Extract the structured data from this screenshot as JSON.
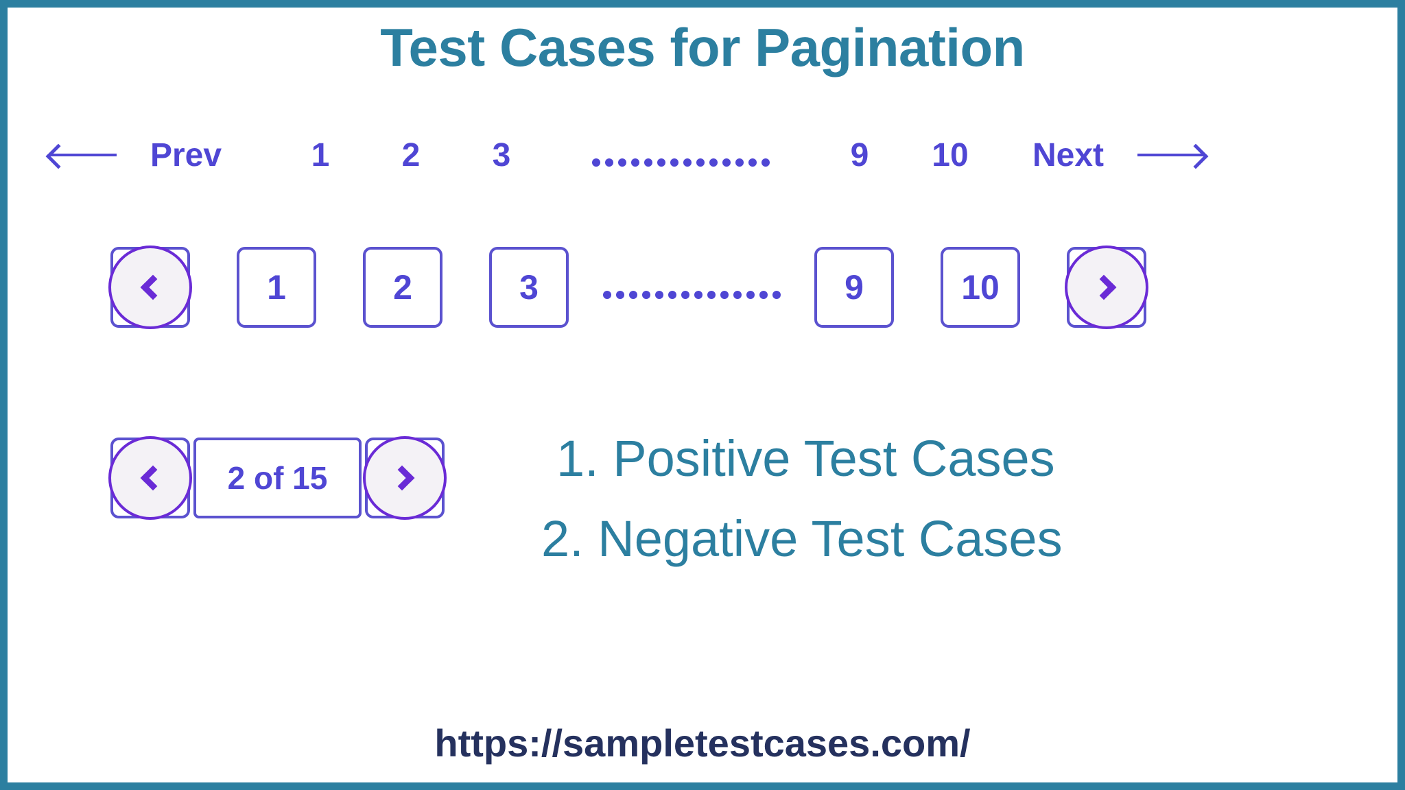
{
  "page": {
    "title": "Test Cases for Pagination",
    "border_color": "#2c7fa0",
    "background": "#ffffff"
  },
  "colors": {
    "teal": "#2c7fa0",
    "purple": "#4f46d4",
    "purple_border": "#5b52cf",
    "purple_deep": "#6a2bd6",
    "circle_fill": "#f4f2f6",
    "navy": "#25315e"
  },
  "text_pagination": {
    "left_arrow_icon": "long-arrow-left-icon",
    "prev_label": "Prev",
    "pages": [
      "1",
      "2",
      "3"
    ],
    "ellipsis": "..............",
    "ellipsis_dot_count": 14,
    "tail_pages": [
      "9",
      "10"
    ],
    "next_label": "Next",
    "right_arrow_icon": "long-arrow-right-icon"
  },
  "box_pagination": {
    "prev_icon": "chevron-left-icon",
    "pages": [
      "1",
      "2",
      "3"
    ],
    "ellipsis": "..............",
    "ellipsis_dot_count": 14,
    "tail_pages": [
      "9",
      "10"
    ],
    "next_icon": "chevron-right-icon"
  },
  "stepper": {
    "prev_icon": "chevron-left-icon",
    "counter_label": "2 of 15",
    "current_page": 2,
    "total_pages": 15,
    "next_icon": "chevron-right-icon"
  },
  "case_list": {
    "items": [
      "1. Positive Test Cases",
      "2. Negative Test Cases"
    ]
  },
  "footer": {
    "url": "https://sampletestcases.com/"
  }
}
